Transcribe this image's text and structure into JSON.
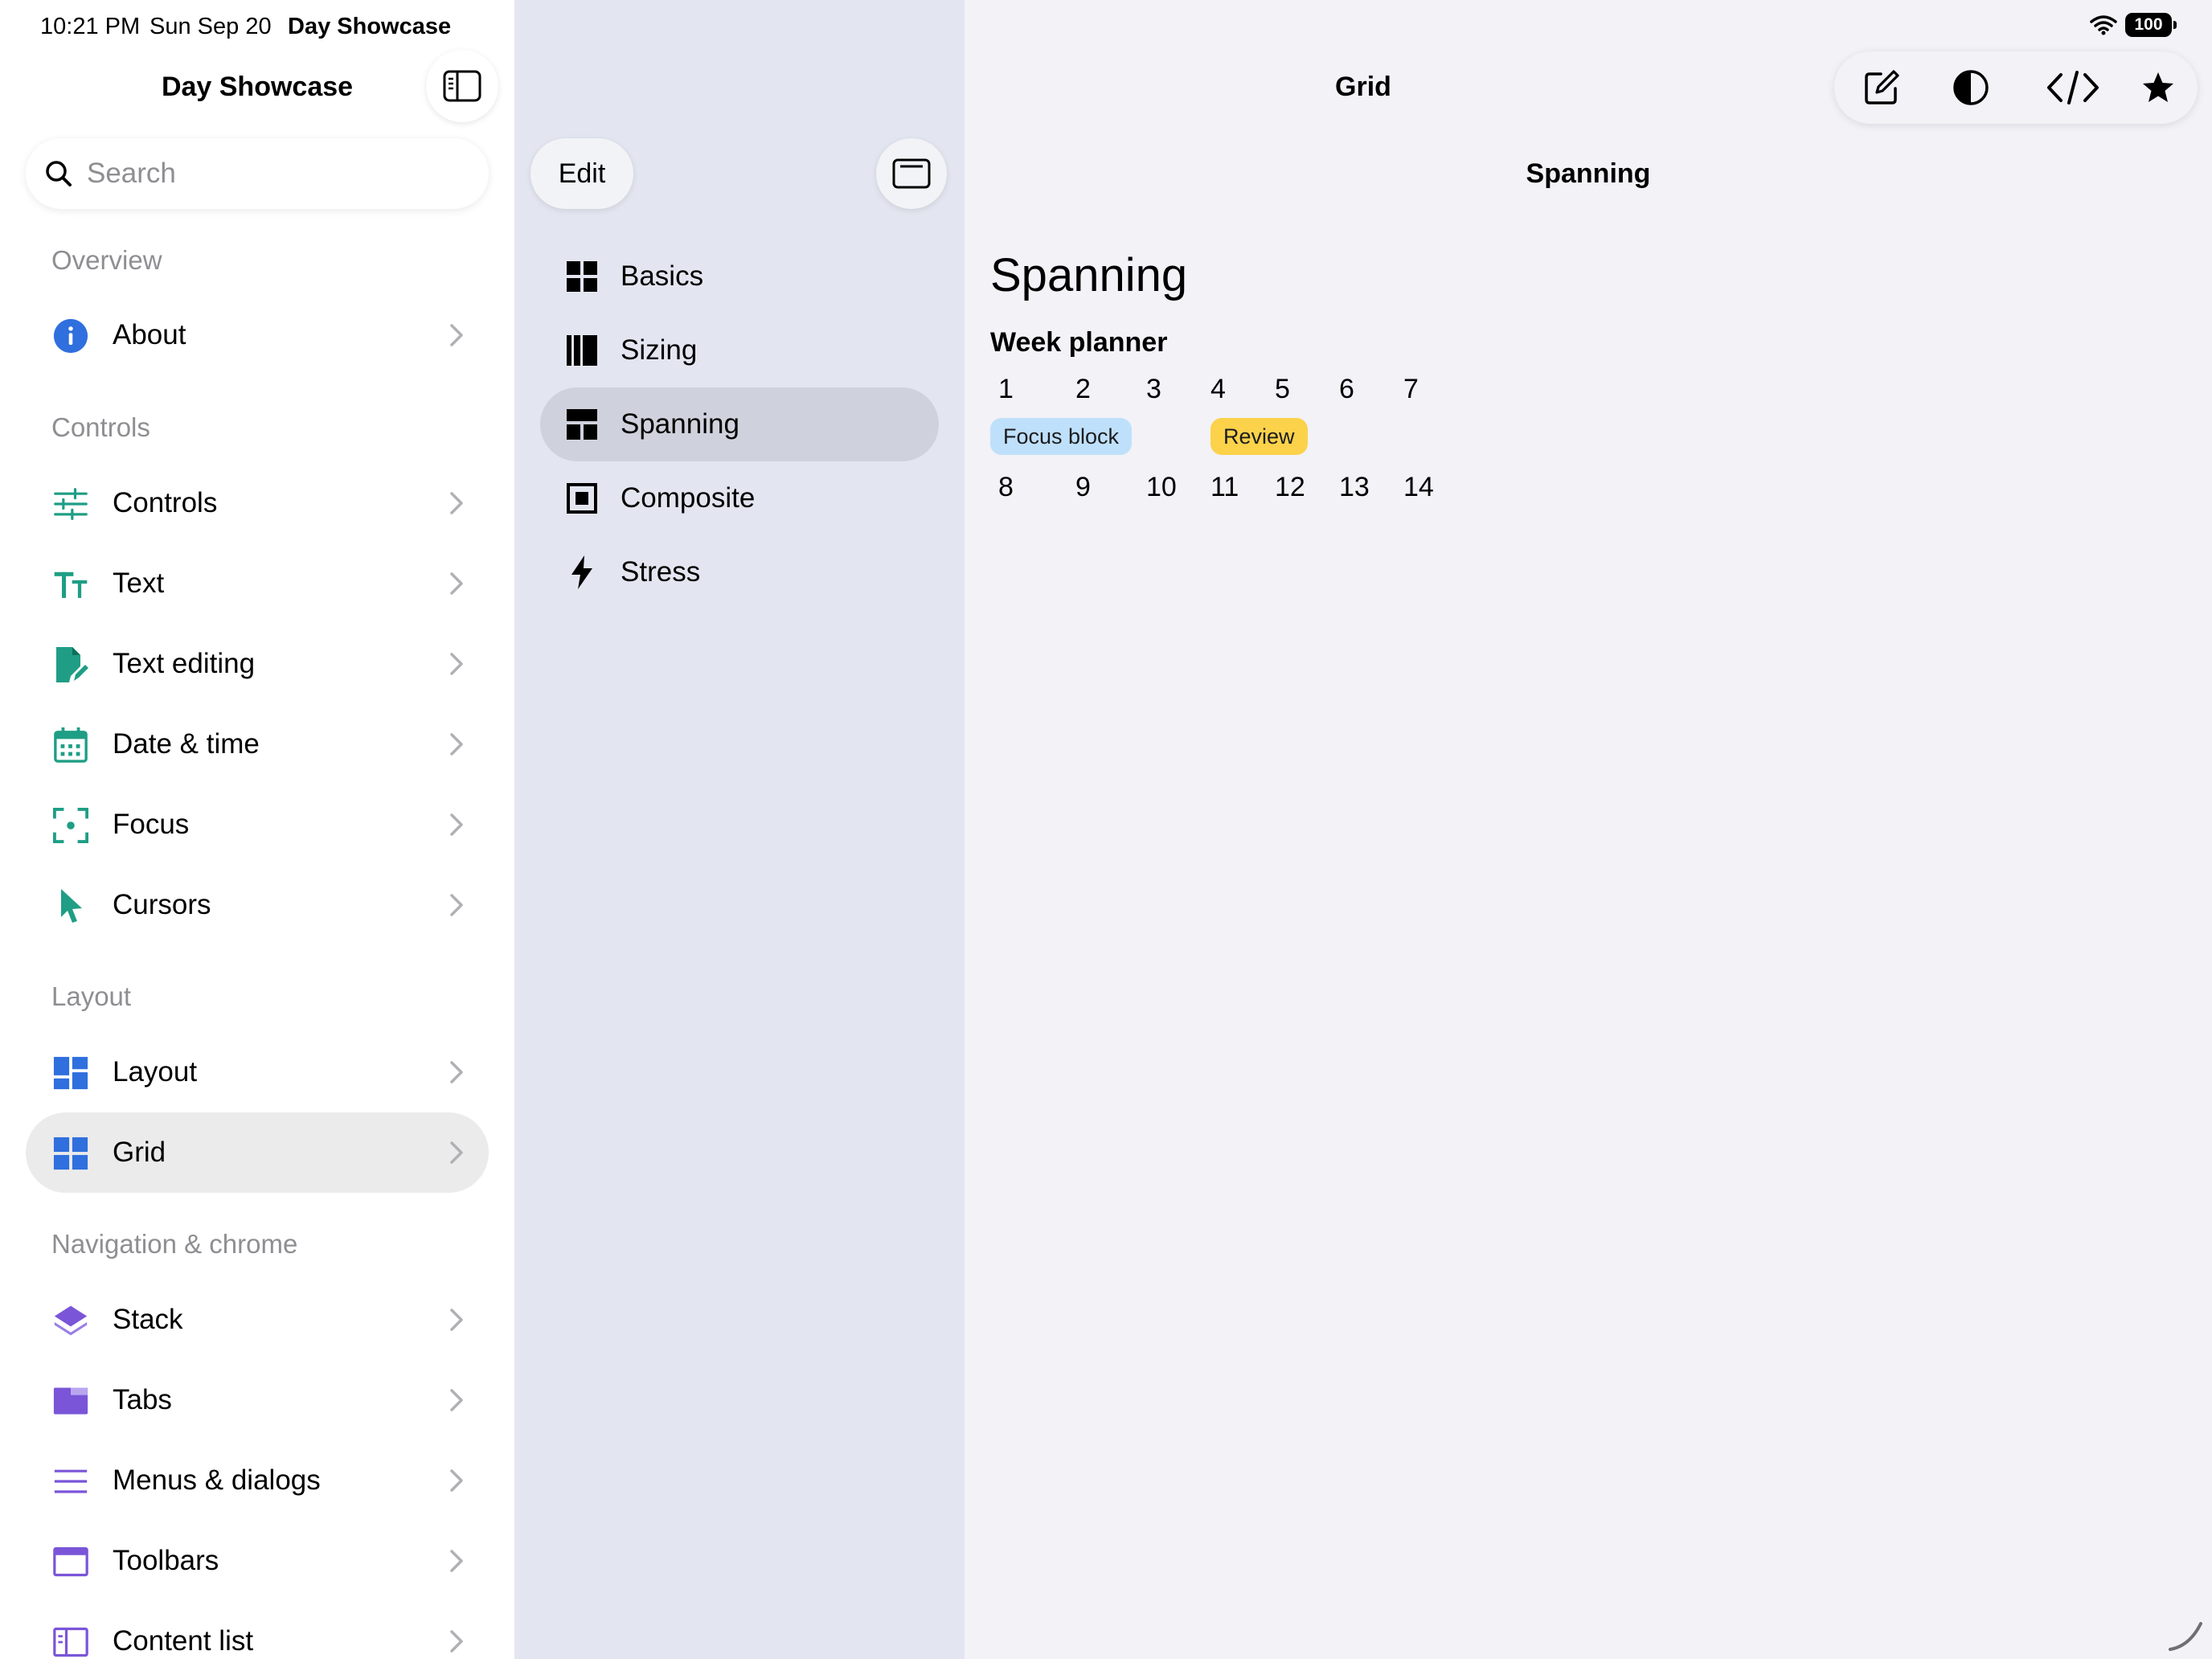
{
  "status_bar": {
    "time": "10:21 PM",
    "date": "Sun Sep 20",
    "app": "Day Showcase",
    "battery": "100"
  },
  "sidebar": {
    "title": "Day Showcase",
    "search_placeholder": "Search",
    "sections": [
      {
        "header": "Overview",
        "items": [
          {
            "label": "About",
            "icon": "info-icon",
            "color": "#2f6fde"
          }
        ]
      },
      {
        "header": "Controls",
        "items": [
          {
            "label": "Controls",
            "icon": "sliders-icon",
            "color": "#1f9e85"
          },
          {
            "label": "Text",
            "icon": "text-size-icon",
            "color": "#1f9e85"
          },
          {
            "label": "Text editing",
            "icon": "document-edit-icon",
            "color": "#1f9e85"
          },
          {
            "label": "Date & time",
            "icon": "calendar-icon",
            "color": "#1f9e85"
          },
          {
            "label": "Focus",
            "icon": "focus-icon",
            "color": "#1f9e85"
          },
          {
            "label": "Cursors",
            "icon": "cursor-icon",
            "color": "#1f9e85"
          }
        ]
      },
      {
        "header": "Layout",
        "items": [
          {
            "label": "Layout",
            "icon": "layout-grid-icon",
            "color": "#2f6fde"
          },
          {
            "label": "Grid",
            "icon": "grid-icon",
            "color": "#2f6fde",
            "selected": true
          }
        ]
      },
      {
        "header": "Navigation & chrome",
        "items": [
          {
            "label": "Stack",
            "icon": "stack-icon",
            "color": "#7a55d8"
          },
          {
            "label": "Tabs",
            "icon": "tabs-icon",
            "color": "#7a55d8"
          },
          {
            "label": "Menus & dialogs",
            "icon": "menu-icon",
            "color": "#7a55d8"
          },
          {
            "label": "Toolbars",
            "icon": "toolbar-icon",
            "color": "#7a55d8"
          },
          {
            "label": "Content list",
            "icon": "content-list-icon",
            "color": "#7a55d8"
          }
        ]
      }
    ]
  },
  "middle": {
    "edit_label": "Edit",
    "items": [
      {
        "label": "Basics",
        "icon": "basics-grid-icon"
      },
      {
        "label": "Sizing",
        "icon": "sizing-columns-icon"
      },
      {
        "label": "Spanning",
        "icon": "spanning-icon",
        "selected": true
      },
      {
        "label": "Composite",
        "icon": "composite-icon"
      },
      {
        "label": "Stress",
        "icon": "bolt-icon"
      }
    ]
  },
  "detail": {
    "title": "Grid",
    "subtitle": "Spanning",
    "large_title": "Spanning",
    "planner_title": "Week planner",
    "week1": [
      "1",
      "2",
      "3",
      "4",
      "5",
      "6",
      "7"
    ],
    "week2": [
      "8",
      "9",
      "10",
      "11",
      "12",
      "13",
      "14"
    ],
    "events": [
      {
        "label": "Focus block",
        "color": "#bfe0fb"
      },
      {
        "label": "Review",
        "color": "#fbd24a"
      }
    ],
    "toolbar": [
      "compose-icon",
      "contrast-icon",
      "code-icon",
      "star-icon"
    ]
  }
}
